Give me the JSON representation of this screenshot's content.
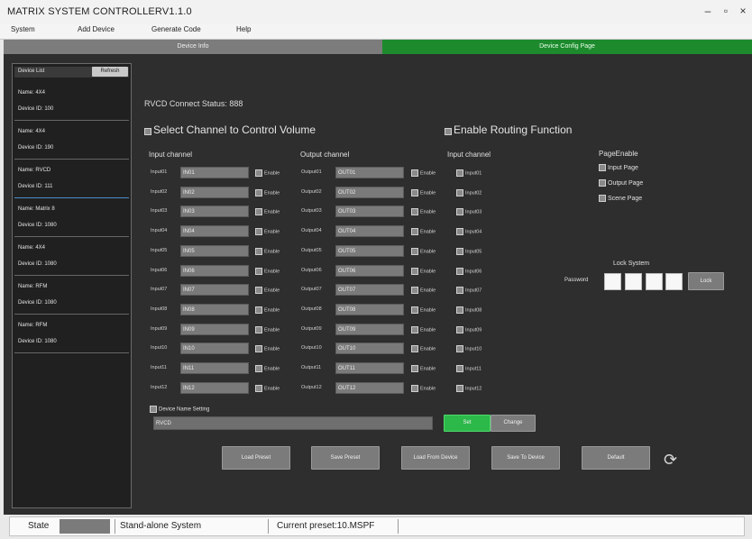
{
  "window": {
    "title": "MATRIX SYSTEM CONTROLLERV1.1.0",
    "min_icon": "minimize-icon",
    "max_icon": "maximize-icon",
    "close_icon": "close-icon",
    "min_glyph": "–",
    "max_glyph": "▫",
    "close_glyph": "×"
  },
  "menu": [
    "System",
    "Add Device",
    "Generate Code",
    "Help"
  ],
  "tabs": {
    "left": "Device Info",
    "right": "Device Config Page"
  },
  "sidebar": {
    "header": "Device List",
    "refresh": "Refresh",
    "devices": [
      {
        "name": "Name: 4X4",
        "id": "Device ID: 100"
      },
      {
        "name": "Name: 4X4",
        "id": "Device ID: 190"
      },
      {
        "name": "Name: RVCD",
        "id": "Device ID: 111"
      },
      {
        "name": "Name: Matrix 8",
        "id": "Device ID: 1080"
      },
      {
        "name": "Name: 4X4",
        "id": "Device ID: 1080"
      },
      {
        "name": "Name: RFM",
        "id": "Device ID: 1080"
      },
      {
        "name": "Name: RFM",
        "id": "Device ID: 1080"
      }
    ]
  },
  "main": {
    "connect_status": "RVCD Connect Status: 888",
    "volume_title": "Select Channel to Control Volume",
    "routing_title": "Enable Routing Function",
    "input_header": "Input channel",
    "output_header": "Output channel",
    "routing_input_header": "Input channel",
    "enable_label": "Enable",
    "inputs": [
      {
        "label": "Input01",
        "value": "IN01",
        "routing": "Input01"
      },
      {
        "label": "Input02",
        "value": "IN02",
        "routing": "Input02"
      },
      {
        "label": "Input03",
        "value": "IN03",
        "routing": "Input03"
      },
      {
        "label": "Input04",
        "value": "IN04",
        "routing": "Input04"
      },
      {
        "label": "Input05",
        "value": "IN05",
        "routing": "Input05"
      },
      {
        "label": "Input06",
        "value": "IN06",
        "routing": "Input06"
      },
      {
        "label": "Input07",
        "value": "IN07",
        "routing": "Input07"
      },
      {
        "label": "Input08",
        "value": "IN08",
        "routing": "Input08"
      },
      {
        "label": "Input09",
        "value": "IN09",
        "routing": "Input09"
      },
      {
        "label": "Input10",
        "value": "IN10",
        "routing": "Input10"
      },
      {
        "label": "Input11",
        "value": "IN11",
        "routing": "Input11"
      },
      {
        "label": "Input12",
        "value": "IN12",
        "routing": "Input12"
      }
    ],
    "outputs": [
      {
        "label": "Output01",
        "value": "OUT01"
      },
      {
        "label": "Output02",
        "value": "OUT02"
      },
      {
        "label": "Output03",
        "value": "OUT03"
      },
      {
        "label": "Output04",
        "value": "OUT04"
      },
      {
        "label": "Output05",
        "value": "OUT05"
      },
      {
        "label": "Output06",
        "value": "OUT06"
      },
      {
        "label": "Output07",
        "value": "OUT07"
      },
      {
        "label": "Output08",
        "value": "OUT08"
      },
      {
        "label": "Output09",
        "value": "OUT09"
      },
      {
        "label": "Output10",
        "value": "OUT10"
      },
      {
        "label": "Output11",
        "value": "OUT11"
      },
      {
        "label": "Output12",
        "value": "OUT12"
      }
    ],
    "page_enable": {
      "title": "PageEnable",
      "items": [
        "Input Page",
        "Output Page",
        "Scene Page"
      ]
    },
    "lock": {
      "title": "Lock System",
      "password_label": "Password",
      "button": "Lock"
    },
    "device_name": {
      "label": "Device Name Setting",
      "value": "RVCD",
      "set": "Set",
      "change": "Change"
    },
    "actions": [
      "Load Preset",
      "Save Preset",
      "Load From Device",
      "Save To Device",
      "Default"
    ],
    "loading_icon": "spinner-icon",
    "loading_glyph": "⟳"
  },
  "statusbar": {
    "state": "State",
    "mode": "Stand-alone System",
    "preset": "Current preset:10.MSPF"
  },
  "colors": {
    "accent_green": "#1d8a2d",
    "panel_dark": "#2e2e2e",
    "set_green": "#2db84a"
  }
}
